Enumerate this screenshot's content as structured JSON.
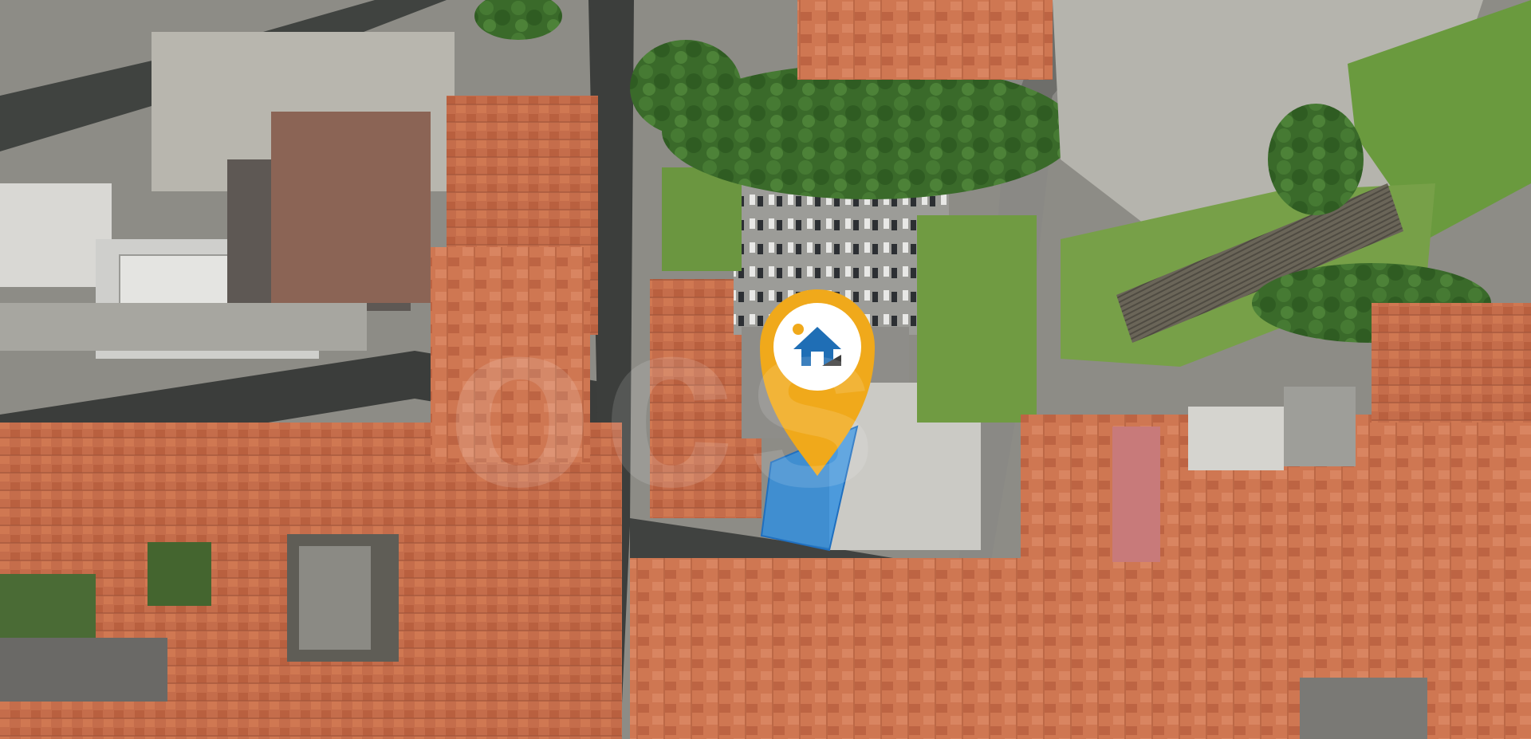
{
  "map": {
    "type": "satellite",
    "watermark_text": "ocs",
    "pin": {
      "icon": "house-icon",
      "pin_color": "#f0a91b",
      "badge_color": "#ffffff",
      "house_color": "#1f6eb5",
      "dot_color": "#f0a91b"
    },
    "highlight_parcel_color": "#2f8fe0",
    "colors": {
      "roof": "#c9704f",
      "road": "#3e403e",
      "tree": "#3b6d2c",
      "grass": "#6e9a3e",
      "plaza": "#b9b8b2"
    }
  }
}
